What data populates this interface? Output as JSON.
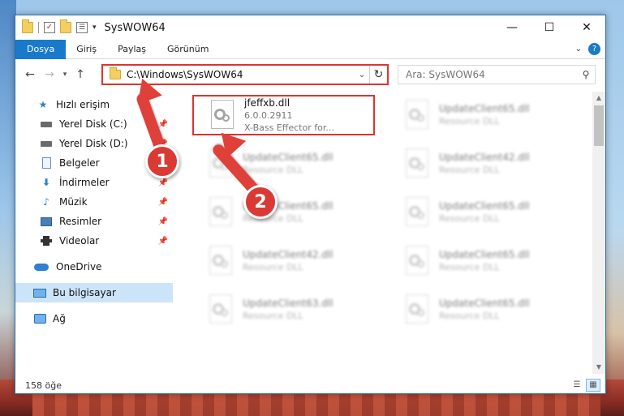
{
  "window": {
    "title": "SysWOW64",
    "controls": {
      "minimize": "—",
      "maximize": "☐",
      "close": "✕"
    }
  },
  "quick_access": {
    "dropdown": "▾"
  },
  "ribbon": {
    "tabs": [
      "Dosya",
      "Giriş",
      "Paylaş",
      "Görünüm"
    ],
    "expand": "⌄",
    "help": "?"
  },
  "nav": {
    "back": "←",
    "forward": "→",
    "recent": "▾",
    "up": "↑"
  },
  "address": {
    "path": "C:\\Windows\\SysWOW64",
    "dropdown": "⌄",
    "refresh": "↻"
  },
  "search": {
    "placeholder": "Ara: SysWOW64",
    "icon": "search-icon"
  },
  "sidebar": {
    "items": [
      {
        "label": "Hızlı erişim",
        "icon": "star-icon"
      },
      {
        "label": "Yerel Disk (C:)",
        "icon": "drive-icon",
        "pinned": true
      },
      {
        "label": "Yerel Disk (D:)",
        "icon": "drive-icon",
        "pinned": true
      },
      {
        "label": "Belgeler",
        "icon": "documents-icon",
        "pinned": true
      },
      {
        "label": "İndirmeler",
        "icon": "downloads-icon",
        "pinned": true
      },
      {
        "label": "Müzik",
        "icon": "music-icon",
        "pinned": true
      },
      {
        "label": "Resimler",
        "icon": "pictures-icon",
        "pinned": true
      },
      {
        "label": "Videolar",
        "icon": "videos-icon",
        "pinned": true
      },
      {
        "label": "OneDrive",
        "icon": "onedrive-icon"
      },
      {
        "label": "Bu bilgisayar",
        "icon": "this-pc-icon",
        "selected": true
      },
      {
        "label": "Ağ",
        "icon": "network-icon"
      }
    ],
    "pin_glyph": "📌"
  },
  "files": [
    {
      "name": "jfeffxb.dll",
      "line2": "6.0.0.2911",
      "line3": "X-Bass Effector for...",
      "highlighted": true
    },
    {
      "name": "UpdateClient65.dll",
      "line2": "Resource DLL",
      "line3": "",
      "blurred": true
    },
    {
      "name": "UpdateClient65.dll",
      "line2": "Resource DLL",
      "line3": "",
      "blurred": true
    },
    {
      "name": "UpdateClient42.dll",
      "line2": "Resource DLL",
      "line3": "",
      "blurred": true
    },
    {
      "name": "UpdateClient65.dll",
      "line2": "Resource DLL",
      "line3": "",
      "blurred": true
    },
    {
      "name": "UpdateClient65.dll",
      "line2": "Resource DLL",
      "line3": "",
      "blurred": true
    },
    {
      "name": "UpdateClient42.dll",
      "line2": "Resource DLL",
      "line3": "",
      "blurred": true
    },
    {
      "name": "UpdateClient65.dll",
      "line2": "Resource DLL",
      "line3": "",
      "blurred": true
    },
    {
      "name": "UpdateClient63.dll",
      "line2": "Resource DLL",
      "line3": "",
      "blurred": true
    },
    {
      "name": "UpdateClient65.dll",
      "line2": "Resource DLL",
      "line3": "",
      "blurred": true
    }
  ],
  "status": {
    "count": "158 öğe"
  },
  "annotations": {
    "step1": "1",
    "step2": "2"
  },
  "colors": {
    "accent": "#1979ca",
    "highlight": "#e0332f",
    "selected_bg": "#cce4f7"
  }
}
